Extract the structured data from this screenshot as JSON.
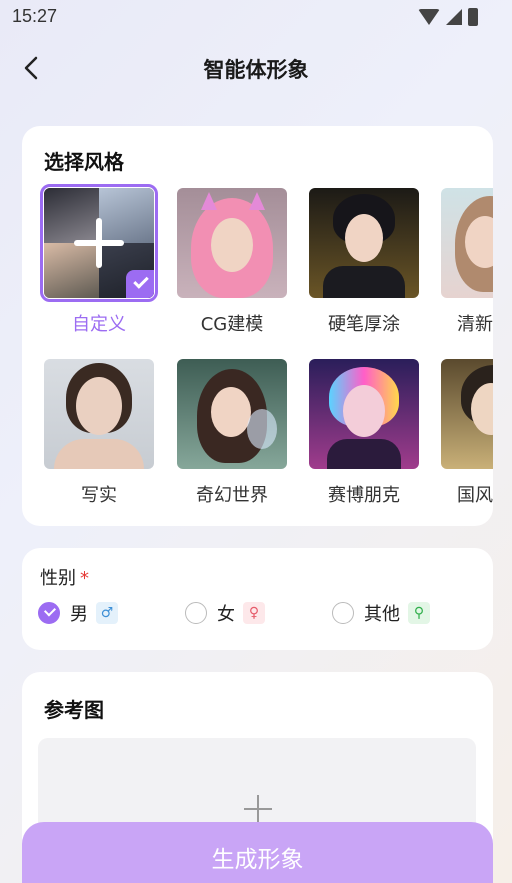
{
  "status_bar": {
    "time": "15:27"
  },
  "nav": {
    "title": "智能体形象"
  },
  "style_section": {
    "title": "选择风格",
    "styles": [
      {
        "label": "自定义",
        "selected": true
      },
      {
        "label": "CG建模",
        "selected": false
      },
      {
        "label": "硬笔厚涂",
        "selected": false
      },
      {
        "label": "清新",
        "selected": false
      },
      {
        "label": "写实",
        "selected": false
      },
      {
        "label": "奇幻世界",
        "selected": false
      },
      {
        "label": "赛博朋克",
        "selected": false
      },
      {
        "label": "国风",
        "selected": false
      }
    ]
  },
  "gender_section": {
    "title": "性别",
    "required_mark": "*",
    "options": [
      {
        "label": "男",
        "symbol": "♂",
        "selected": true
      },
      {
        "label": "女",
        "symbol": "♀",
        "selected": false
      },
      {
        "label": "其他",
        "symbol": "⚲",
        "selected": false
      }
    ]
  },
  "reference_section": {
    "title": "参考图",
    "upload_icon": "plus-icon"
  },
  "generate_button": {
    "label": "生成形象"
  },
  "colors": {
    "accent": "#9c6cf2",
    "button": "#c9a5f6"
  }
}
